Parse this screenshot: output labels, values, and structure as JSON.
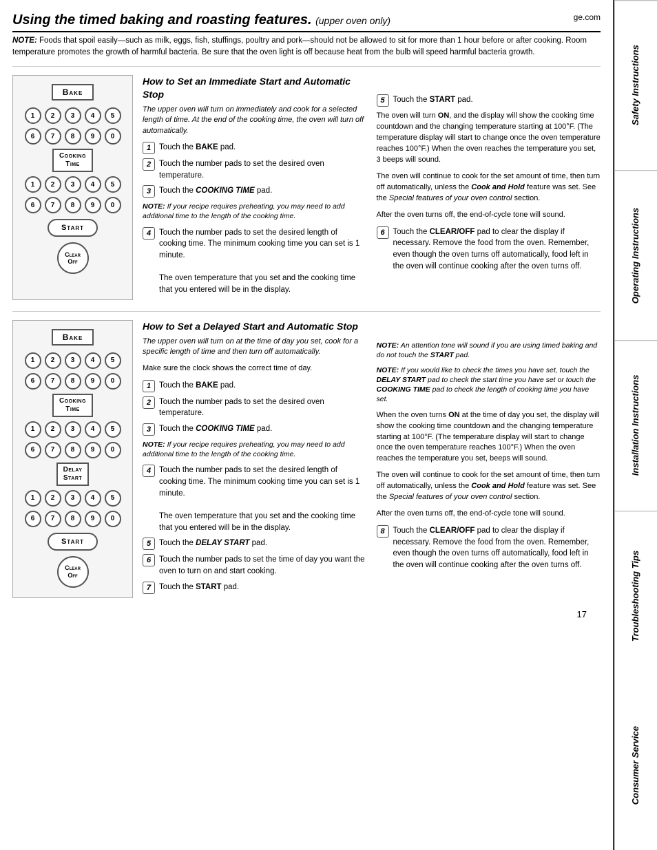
{
  "page": {
    "title": "Using the timed baking and roasting features.",
    "subtitle": "(upper oven only)",
    "ge_com": "ge.com",
    "note": "NOTE:  Foods that spoil easily—such as milk, eggs, fish, stuffings, poultry and pork—should not be allowed to sit for more than 1 hour before or after cooking. Room temperature promotes the growth of harmful bacteria. Be sure that the oven light is off because heat from the bulb will speed harmful bacteria growth."
  },
  "section1": {
    "heading": "How to Set an Immediate Start and Automatic Stop",
    "intro": "The upper oven will turn on immediately and cook for a selected length of time. At the end of the cooking time, the oven will turn off automatically.",
    "steps": [
      {
        "num": "1",
        "text": "Touch the BAKE pad.",
        "bold": "BAKE"
      },
      {
        "num": "2",
        "text": "Touch the number pads to set the desired oven temperature."
      },
      {
        "num": "3",
        "text": "Touch the COOKING TIME pad.",
        "bold": "COOKING TIME"
      },
      {
        "num": "4",
        "text": "Touch the number pads to set the desired length of cooking time. The minimum cooking time you can set is 1 minute.\n\nThe oven temperature that you set and the cooking time that you entered will be in the display."
      },
      {
        "num": "5",
        "text": "Touch the START pad.",
        "bold": "START"
      }
    ],
    "note1": "NOTE: If your recipe requires preheating, you may need to add additional time to the length of the cooking time.",
    "right_text1": "The oven will turn ON, and the display will show the cooking time countdown and the changing temperature starting at 100°F. (The temperature display will start to change once the oven temperature reaches 100°F.) When the oven reaches the temperature you set, 3 beeps will sound.",
    "right_text2": "The oven will continue to cook for the set amount of time, then turn off automatically, unless the Cook and Hold feature was set. See the Special features of your oven control section.",
    "right_text3": "After the oven turns off, the end-of-cycle tone will sound.",
    "step6_text": "Touch the CLEAR/OFF pad to clear the display if necessary. Remove the food from the oven. Remember, even though the oven turns off automatically, food left in the oven will continue cooking after the oven turns off.",
    "step6_num": "6",
    "step6_bold": "CLEAR/OFF"
  },
  "section2": {
    "heading": "How to Set a Delayed Start and Automatic Stop",
    "intro": "The upper oven will turn on at the time of day you set, cook for a specific length of time and then turn off automatically.",
    "make_sure": "Make sure the clock shows the correct time of day.",
    "steps": [
      {
        "num": "1",
        "text": "Touch the BAKE pad.",
        "bold": "BAKE"
      },
      {
        "num": "2",
        "text": "Touch the number pads to set the desired oven temperature."
      },
      {
        "num": "3",
        "text": "Touch the COOKING TIME pad.",
        "bold": "COOKING TIME"
      },
      {
        "num": "4",
        "text": "Touch the number pads to set the desired length of cooking time. The minimum cooking time you can set is 1 minute.\n\nThe oven temperature that you set and the cooking time that you entered will be in the display."
      },
      {
        "num": "5",
        "text": "Touch the DELAY START pad.",
        "bold": "DELAY START"
      },
      {
        "num": "6",
        "text": "Touch the number pads to set the time of day you want the oven to turn on and start cooking."
      },
      {
        "num": "7",
        "text": "Touch the START pad.",
        "bold": "START"
      }
    ],
    "note1": "NOTE: If your recipe requires preheating, you may need to add additional time to the length of the cooking time.",
    "right_note1": "NOTE: An attention tone will sound if you are using timed baking and do not touch the START pad.",
    "right_note2": "NOTE: If you would like to check the times you have set, touch the DELAY START pad to check the start time you have set or touch the COOKING TIME pad to check the length of cooking time you have set.",
    "right_text1": "When the oven turns ON at the time of day you set, the display will show the cooking time countdown and the changing temperature starting at 100°F. (The temperature display will start to change once the oven temperature reaches 100°F.) When the oven reaches the temperature you set, beeps will sound.",
    "right_text2": "The oven will continue to cook for the set amount of time, then turn off automatically, unless the Cook and Hold feature was set. See the Special features of your oven control section.",
    "right_text3": "After the oven turns off, the end-of-cycle tone will sound.",
    "step8_text": "Touch the CLEAR/OFF pad to clear the display if necessary. Remove the food from the oven. Remember, even though the oven turns off automatically, food left in the oven will continue cooking after the oven turns off.",
    "step8_num": "8",
    "step8_bold": "CLEAR/OFF"
  },
  "panel1": {
    "bake_label": "Bake",
    "row1": [
      "1",
      "2",
      "3",
      "4",
      "5"
    ],
    "row2": [
      "6",
      "7",
      "8",
      "9",
      "0"
    ],
    "cooking_time": "Cooking\nTime",
    "row3": [
      "1",
      "2",
      "3",
      "4",
      "5"
    ],
    "row4": [
      "6",
      "7",
      "8",
      "9",
      "0"
    ],
    "start": "Start",
    "clear": "Clear\nOff"
  },
  "panel2": {
    "bake_label": "Bake",
    "row1": [
      "1",
      "2",
      "3",
      "4",
      "5"
    ],
    "row2": [
      "6",
      "7",
      "8",
      "9",
      "0"
    ],
    "cooking_time": "Cooking\nTime",
    "row3": [
      "1",
      "2",
      "3",
      "4",
      "5"
    ],
    "row4": [
      "6",
      "7",
      "8",
      "9",
      "0"
    ],
    "delay_start": "Delay\nStart",
    "row5": [
      "1",
      "2",
      "3",
      "4",
      "5"
    ],
    "row6": [
      "6",
      "7",
      "8",
      "9",
      "0"
    ],
    "start": "Start",
    "clear": "Clear\nOff"
  },
  "sidebar": {
    "items": [
      "Safety Instructions",
      "Operating Instructions",
      "Installation Instructions",
      "Troubleshooting Tips",
      "Consumer Service"
    ]
  },
  "page_number": "17"
}
